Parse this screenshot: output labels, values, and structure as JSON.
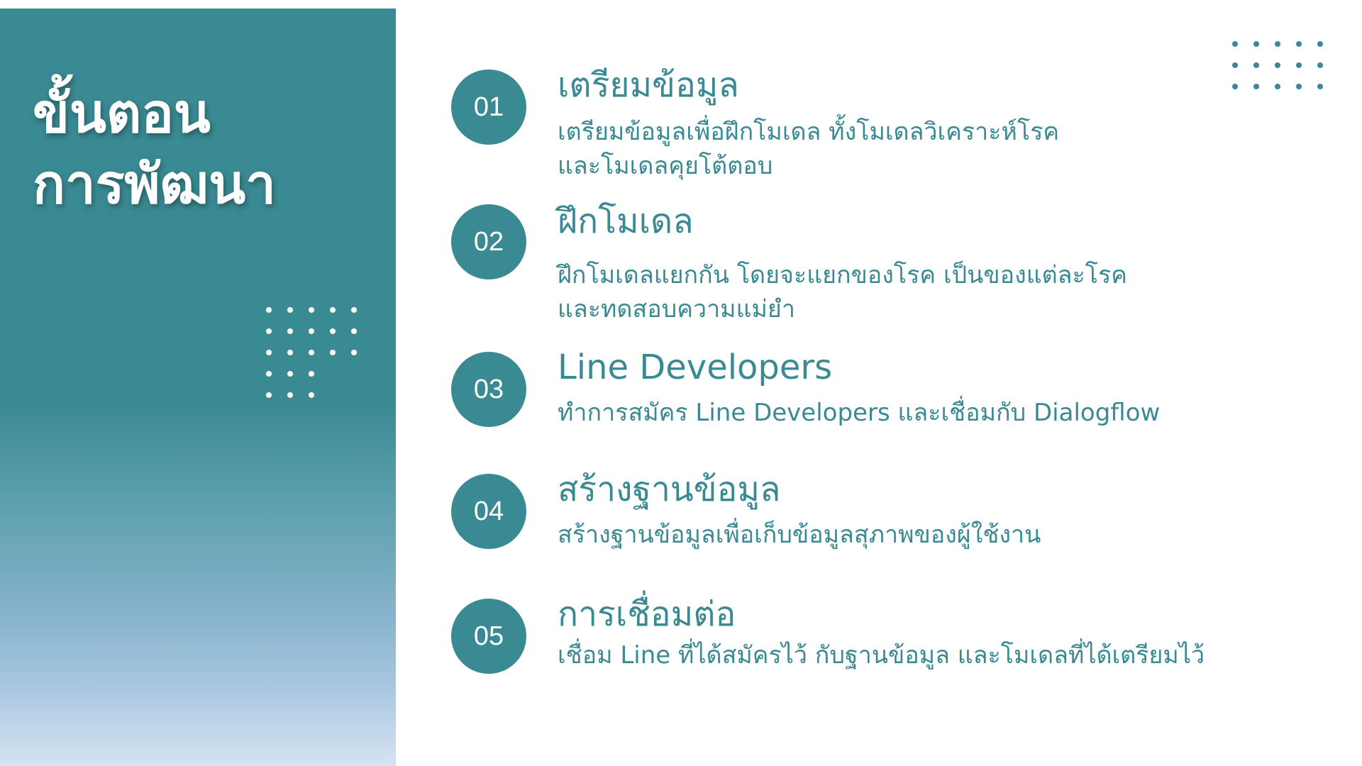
{
  "slide": {
    "title_lines": [
      "ขั้นตอน",
      "การพัฒนา"
    ],
    "accent_color": "#3a8a93"
  },
  "steps": [
    {
      "number": "01",
      "title": "เตรียมข้อมูล",
      "description_lines": [
        "เตรียมข้อมูลเพื่อฝึกโมเดล ทั้งโมเดลวิเคราะห์โรค",
        "และโมเดลคุยโต้ตอบ"
      ]
    },
    {
      "number": "02",
      "title": "ฝึกโมเดล",
      "description_lines": [
        "ฝึกโมเดลแยกกัน โดยจะแยกของโรค เป็นของแต่ละโรค",
        "และทดสอบความแม่ยำ"
      ]
    },
    {
      "number": "03",
      "title": "Line Developers",
      "description_lines": [
        "ทำการสมัคร Line Developers และเชื่อมกับ Dialogflow"
      ]
    },
    {
      "number": "04",
      "title": "สร้างฐานข้อมูล",
      "description_lines": [
        "สร้างฐานข้อมูลเพื่อเก็บข้อมูลสุภาพของผู้ใช้งาน"
      ]
    },
    {
      "number": "05",
      "title": "การเชื่อมต่อ",
      "description_lines": [
        "เชื่อม Line ที่ได้สมัครไว้ กับฐานข้อมูล และโมเดลที่ได้เตรียมไว้"
      ]
    }
  ]
}
